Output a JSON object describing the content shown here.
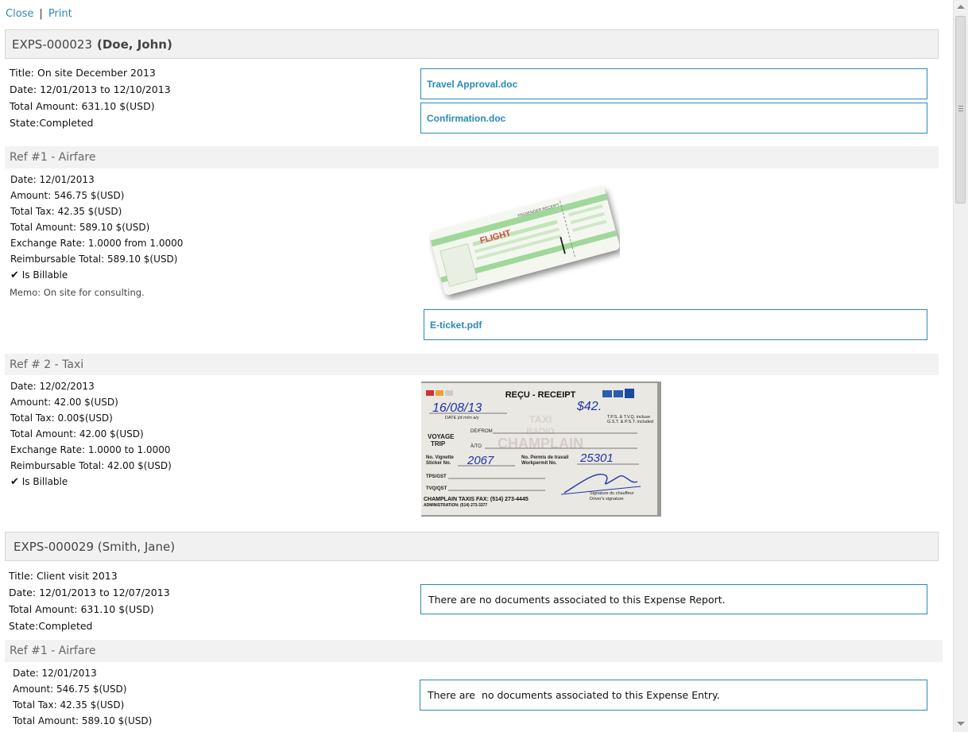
{
  "toolbar": {
    "close_label": "Close",
    "separator": "|",
    "print_label": "Print"
  },
  "reports": [
    {
      "id": "EXPS-000023",
      "owner": "(Doe, John)",
      "title_label": "Title:",
      "title": "On site December 2013",
      "date_label": "Date:",
      "date": "12/01/2013 to 12/10/2013",
      "total_label": "Total Amount:",
      "total": "631.10 $(USD)",
      "state_label": "State:",
      "state": "Completed",
      "documents": [
        "Travel Approval.doc",
        "Confirmation.doc"
      ],
      "entries": [
        {
          "header": "Ref #1 - Airfare",
          "date": "Date: 12/01/2013",
          "amount": "Amount: 546.75 $(USD)",
          "tax": "Total Tax: 42.35 $(USD)",
          "total": "Total Amount: 589.10 $(USD)",
          "exchange": "Exchange Rate: 1.0000 from 1.0000",
          "reimbursable": "Reimbursable Total: 589.10 $(USD)",
          "billable": "Is Billable",
          "memo": "Memo: On site for consulting.",
          "document": "E-ticket.pdf",
          "ticket": {
            "label": "FLIGHT",
            "receipt_text": "PASSENGER RECEIPT"
          }
        },
        {
          "header": "Ref # 2 - Taxi",
          "date": "Date: 12/02/2013",
          "amount": "Amount: 42.00 $(USD)",
          "tax": "Total Tax: 0.00$(USD)",
          "total": "Total Amount: 42.00 $(USD)",
          "exchange": "Exchange Rate: 1.0000 to 1.0000",
          "reimbursable": "Reimbursable Total: 42.00 $(USD)",
          "billable": "Is Billable",
          "receipt": {
            "title": "REÇU - RECEIPT",
            "date": "16/08/13",
            "amount": "$42.",
            "date_caption": "DATE j/d m/m a/y",
            "tax_note1": "T.P.S. & T.V.Q. incluse",
            "tax_note2": "G.S.T. & P.S.T. included",
            "voyage": "VOYAGE",
            "trip": "TRIP",
            "from": "DE/FROM",
            "to": "À/TO",
            "vignette1": "No. Vignette",
            "vignette2": "Sticker No.",
            "sticker_value": "2067",
            "permit1": "No. Permis de travail",
            "permit2": "Workpermit No.",
            "permit_value": "25301",
            "tps": "TPS/GST",
            "tvq": "TVQ/QST",
            "company": "CHAMPLAIN TAXIS  FAX: (514) 273-4445",
            "admin": "ADMINISTRATION: (514) 273-3377",
            "signature1": "Signature du chauffeur",
            "signature2": "Driver's signature",
            "watermark1": "TAXI",
            "watermark2": "RADIO",
            "watermark3": "CHAMPLAIN"
          }
        }
      ]
    },
    {
      "id": "EXPS-000029",
      "owner": "(Smith, Jane)",
      "title_label": "Title:",
      "title": "Client visit 2013",
      "date_label": "Date:",
      "date": "12/01/2013 to 12/07/2013",
      "total_label": "Total Amount:",
      "total": "631.10 $(USD)",
      "state_label": "State:",
      "state": "Completed",
      "no_docs_message": "There are no documents associated to this Expense Report.",
      "entries": [
        {
          "header": "Ref #1 - Airfare",
          "date": "Date: 12/01/2013",
          "amount": "Amount: 546.75 $(USD)",
          "tax": "Total Tax: 42.35 $(USD)",
          "total": "Total Amount: 589.10 $(USD)",
          "no_docs_message": "There are  no documents associated to this Expense Entry."
        }
      ]
    }
  ],
  "colors": {
    "link": "#2a8ab8",
    "header_bg": "#f1f1f1",
    "border": "#2a8ab8"
  }
}
